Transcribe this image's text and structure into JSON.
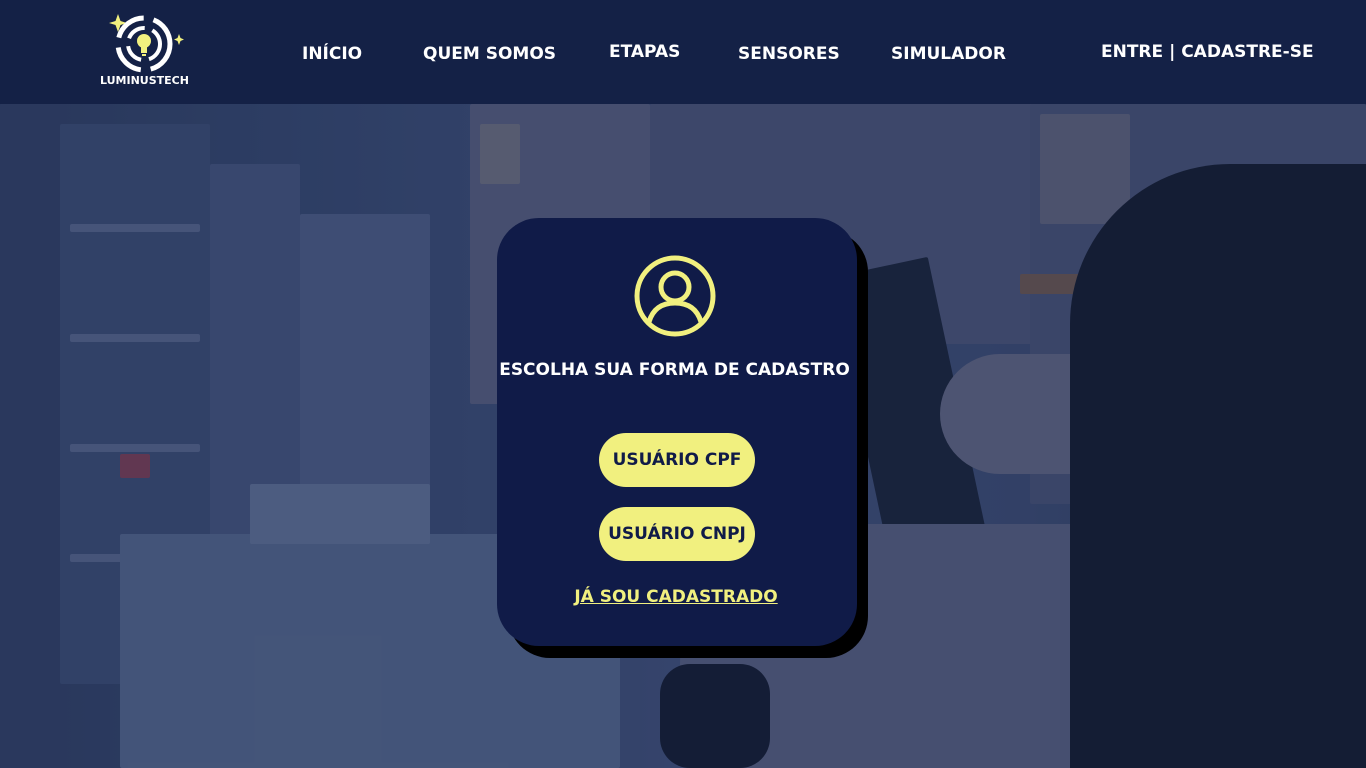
{
  "brand": {
    "name": "LUMINUSTECH",
    "logo_icon": "lightbulb-swirl-logo"
  },
  "nav": {
    "items": [
      {
        "label": "INÍCIO"
      },
      {
        "label": "QUEM SOMOS"
      },
      {
        "label": "ETAPAS"
      },
      {
        "label": "SENSORES"
      },
      {
        "label": "SIMULADOR"
      }
    ],
    "auth": {
      "login_label": "ENTRE",
      "separator": "|",
      "signup_label": "CADASTRE-SE"
    }
  },
  "card": {
    "icon": "user-circle-icon",
    "title": "ESCOLHA SUA FORMA DE CADASTRO",
    "buttons": {
      "cpf_label": "USUÁRIO CPF",
      "cnpj_label": "USUÁRIO CNPJ"
    },
    "login_link": "JÁ SOU CADASTRADO"
  },
  "colors": {
    "navbar_bg": "#142146",
    "card_bg": "#101b48",
    "accent_yellow": "#f1f07f",
    "text_white": "#ffffff"
  }
}
